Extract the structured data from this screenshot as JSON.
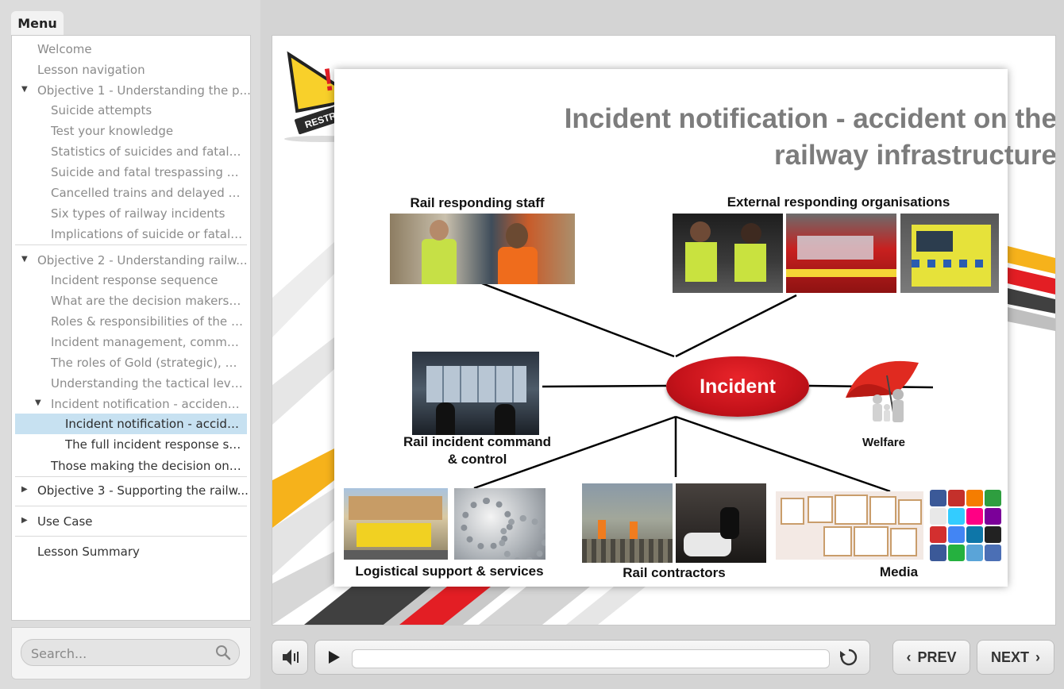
{
  "menu": {
    "tab_label": "Menu",
    "items": [
      {
        "label": "Welcome"
      },
      {
        "label": "Lesson navigation"
      },
      {
        "label": "Objective 1 - Understanding the p..."
      },
      {
        "label": "Suicide attempts"
      },
      {
        "label": "Test your knowledge"
      },
      {
        "label": "Statistics of suicides and fatal tr..."
      },
      {
        "label": "Suicide and fatal trespassing sta..."
      },
      {
        "label": "Cancelled trains and delayed pa..."
      },
      {
        "label": "Six types of railway incidents"
      },
      {
        "label": "Implications of suicide or fatal t..."
      },
      {
        "label": "Objective 2 - Understanding railw..."
      },
      {
        "label": "Incident response sequence"
      },
      {
        "label": "What are the decision makers’ ..."
      },
      {
        "label": "Roles & responsibilities of the r..."
      },
      {
        "label": "Incident management, comman..."
      },
      {
        "label": "The roles of Gold (strategic), Sil..."
      },
      {
        "label": "Understanding the tactical level..."
      },
      {
        "label": "Incident notification - accident ..."
      },
      {
        "label": "Incident notification - accide..."
      },
      {
        "label": "The full incident response se..."
      },
      {
        "label": "Those making the decision on li..."
      },
      {
        "label": "Objective 3 - Supporting the railw..."
      },
      {
        "label": "Use Case"
      },
      {
        "label": "Lesson Summary"
      }
    ]
  },
  "search": {
    "placeholder": "Search..."
  },
  "slide": {
    "logo_text": "RESTRAIL",
    "title_line1": "Incident notification - accident on the",
    "title_line2": "railway infrastructure",
    "center_label": "Incident",
    "nodes": {
      "rail_staff": "Rail responding staff",
      "external": "External responding organisations",
      "command_line1": "Rail incident command",
      "command_line2": "& control",
      "welfare": "Welfare",
      "logistics": "Logistical support & services",
      "contractors": "Rail contractors",
      "media": "Media"
    }
  },
  "controls": {
    "prev_label": "PREV",
    "next_label": "NEXT",
    "progress": 0
  },
  "colors": {
    "selected_row": "#c7e1f1",
    "incident_red": "#c4121a",
    "title_gray": "#7c7c7c"
  }
}
